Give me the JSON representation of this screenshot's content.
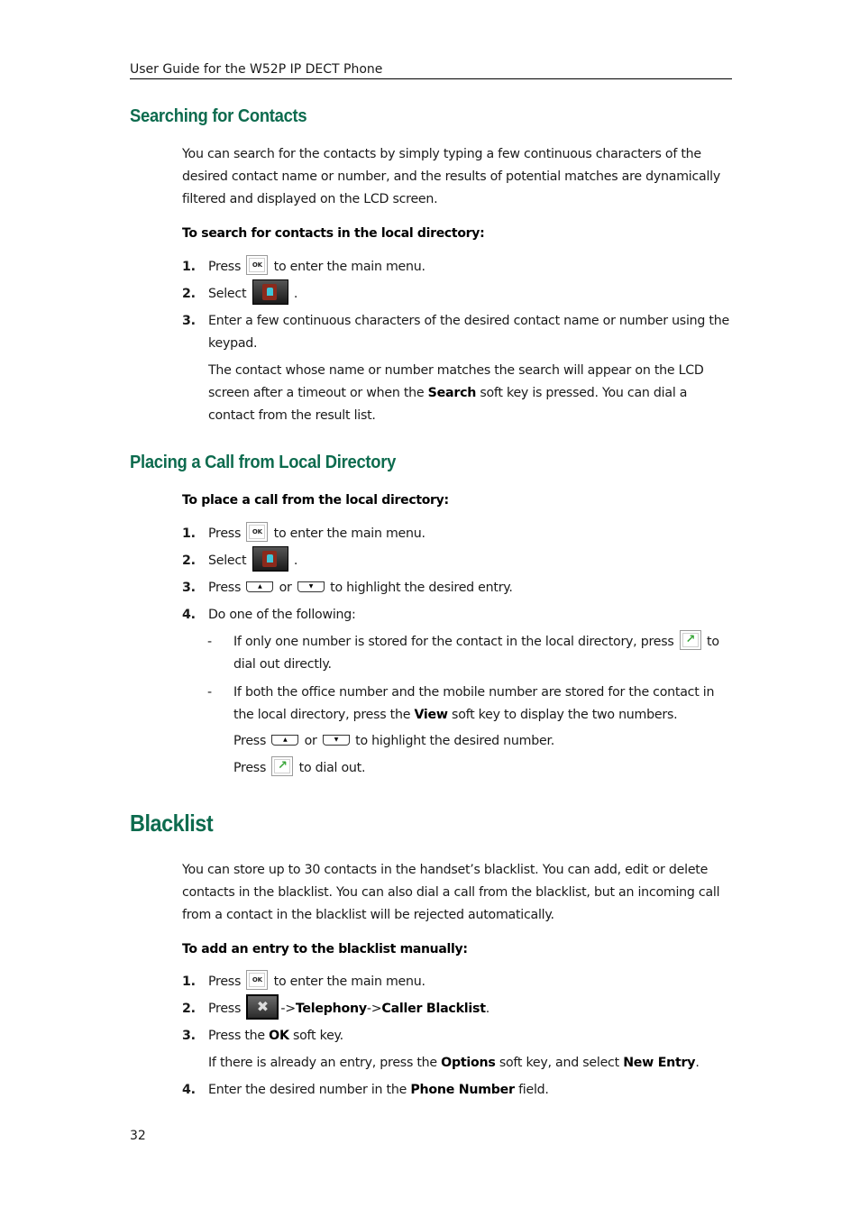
{
  "header": {
    "title": "User Guide for the W52P IP DECT Phone"
  },
  "sections": {
    "searching": {
      "title": "Searching for Contacts",
      "intro": "You can search for the contacts by simply typing a few continuous characters of the desired contact name or number, and the results of potential matches are dynamically filtered and displayed on the LCD screen.",
      "procedure_title": "To search for contacts in the local directory:",
      "steps": [
        {
          "num": "1.",
          "before": "Press",
          "icon": "ok-key-icon",
          "icon_label": "OK",
          "after": "to enter the main menu."
        },
        {
          "num": "2.",
          "before": "Select",
          "icon": "directory-icon",
          "after": "."
        },
        {
          "num": "3.",
          "text": "Enter a few continuous characters of the desired contact name or number using the keypad."
        }
      ],
      "note": {
        "before": "The contact whose name or number matches the search will appear on the LCD screen after a timeout or when the",
        "bold": "Search",
        "after": "soft key is pressed. You can dial a contact from the result list."
      }
    },
    "placing": {
      "title": "Placing a Call from Local Directory",
      "procedure_title": "To place a call from the local directory:",
      "steps": [
        {
          "num": "1.",
          "before": "Press",
          "icon": "ok-key-icon",
          "icon_label": "OK",
          "after": "to enter the main menu."
        },
        {
          "num": "2.",
          "before": "Select",
          "icon": "directory-icon",
          "after": "."
        },
        {
          "num": "3.",
          "before": "Press",
          "icon_up": "up-key-icon",
          "up_glyph": "▲",
          "mid": "or",
          "icon_down": "down-key-icon",
          "down_glyph": "▼",
          "after": "to highlight the desired entry."
        },
        {
          "num": "4.",
          "text": "Do one of the following:"
        }
      ],
      "bullets": [
        {
          "dash": "-",
          "before": "If only one number is stored for the contact in the local directory, press",
          "icon": "call-key-icon",
          "after": "to dial out directly."
        },
        {
          "dash": "-",
          "before": "If both the office number and the mobile number are stored for the contact in the local directory, press the",
          "bold": "View",
          "after": "soft key to display the two numbers."
        }
      ],
      "bullet_cont": [
        {
          "before": "Press",
          "mid": "or",
          "after": "to highlight the desired number.",
          "up_glyph": "▲",
          "down_glyph": "▼"
        },
        {
          "before": "Press",
          "after": "to dial out."
        }
      ]
    },
    "blacklist": {
      "title": "Blacklist",
      "intro": "You can store up to 30 contacts in the handset’s blacklist. You can add, edit or delete contacts in the blacklist. You can also dial a call from the blacklist, but an incoming call from a contact in the blacklist will be rejected automatically.",
      "procedure_title": "To add an entry to the blacklist manually:",
      "steps": [
        {
          "num": "1.",
          "before": "Press",
          "icon": "ok-key-icon",
          "icon_label": "OK",
          "after": "to enter the main menu."
        },
        {
          "num": "2.",
          "before": "Press",
          "icon": "settings-tools-icon",
          "path_sep": "->",
          "path1": "Telephony",
          "path2": "Caller Blacklist",
          "after": "."
        },
        {
          "num": "3.",
          "before": "Press the",
          "bold": "OK",
          "after": "soft key."
        },
        {
          "num": "4.",
          "before": "Enter the desired number in the",
          "bold": "Phone Number",
          "after": "field."
        }
      ],
      "note": {
        "before": "If there is already an entry, press the",
        "bold1": "Options",
        "mid": "soft key, and select",
        "bold2": "New Entry",
        "after": "."
      }
    }
  },
  "footer": {
    "page_number": "32"
  }
}
